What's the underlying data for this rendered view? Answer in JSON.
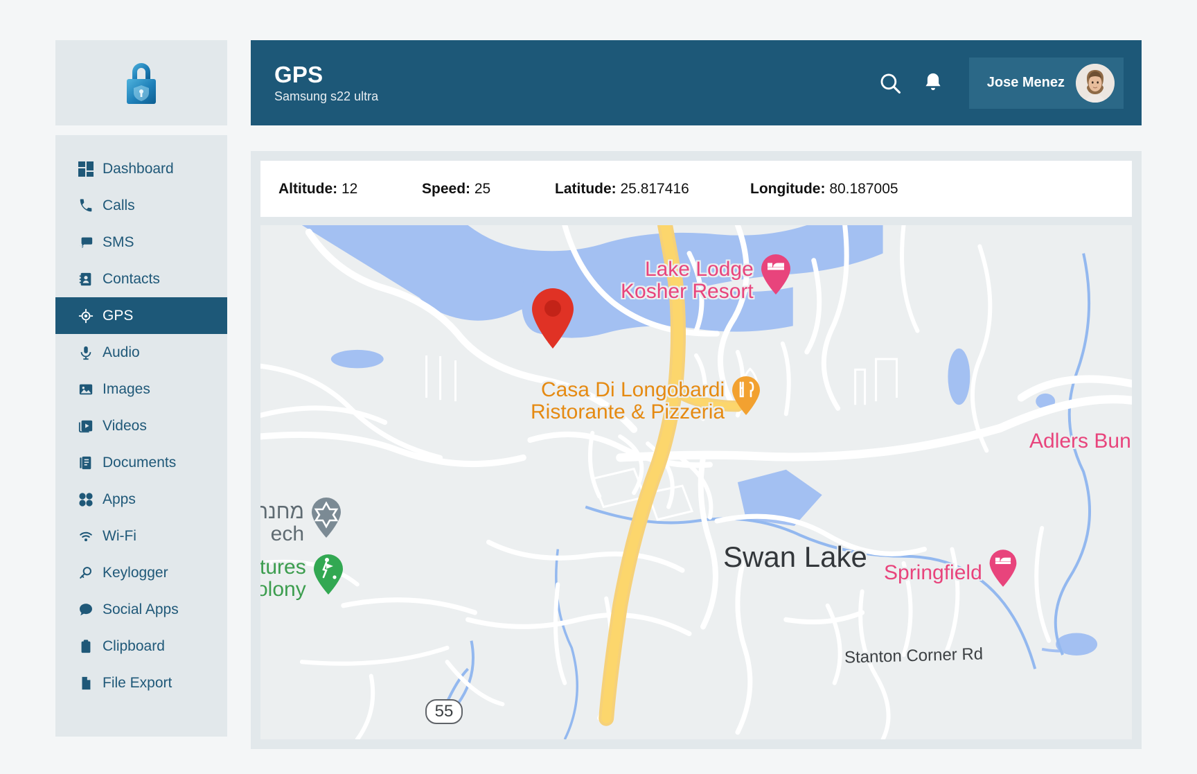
{
  "brand": {
    "logo_icon": "padlock-logo",
    "accent": "#1d5878",
    "panel_bg": "#e2e8eb"
  },
  "sidebar": {
    "items": [
      {
        "label": "Dashboard",
        "icon": "dashboard-icon",
        "active": false
      },
      {
        "label": "Calls",
        "icon": "phone-icon",
        "active": false
      },
      {
        "label": "SMS",
        "icon": "chat-icon",
        "active": false
      },
      {
        "label": "Contacts",
        "icon": "contacts-icon",
        "active": false
      },
      {
        "label": "GPS",
        "icon": "crosshair-icon",
        "active": true
      },
      {
        "label": "Audio",
        "icon": "microphone-icon",
        "active": false
      },
      {
        "label": "Images",
        "icon": "image-icon",
        "active": false
      },
      {
        "label": "Videos",
        "icon": "video-icon",
        "active": false
      },
      {
        "label": "Documents",
        "icon": "document-icon",
        "active": false
      },
      {
        "label": "Apps",
        "icon": "grid-dots-icon",
        "active": false
      },
      {
        "label": "Wi-Fi",
        "icon": "wifi-icon",
        "active": false
      },
      {
        "label": "Keylogger",
        "icon": "key-search-icon",
        "active": false
      },
      {
        "label": "Social Apps",
        "icon": "speech-bubble-icon",
        "active": false
      },
      {
        "label": "Clipboard",
        "icon": "clipboard-icon",
        "active": false
      },
      {
        "label": "File Export",
        "icon": "file-icon",
        "active": false
      }
    ]
  },
  "header": {
    "title": "GPS",
    "subtitle": "Samsung s22 ultra",
    "search_icon": "search-icon",
    "notification_icon": "bell-icon",
    "user_name": "Jose Menez",
    "avatar_icon": "user-avatar"
  },
  "stats": [
    {
      "label": "Altitude:",
      "value": "12"
    },
    {
      "label": "Speed:",
      "value": "25"
    },
    {
      "label": "Latitude:",
      "value": "25.817416"
    },
    {
      "label": "Longitude:",
      "value": "80.187005"
    }
  ],
  "map": {
    "center_marker": "location-pin",
    "place_label": "Swan Lake",
    "road_label": "Stanton Corner Rd",
    "route_shield": "55",
    "pois": [
      {
        "name": "Lake Lodge Kosher Resort",
        "line1": "Lake Lodge",
        "line2": "Kosher Resort",
        "color": "pink",
        "pin": "hotel-pin",
        "pin_color": "#e8447c"
      },
      {
        "name": "Casa Di Longobardi Ristorante & Pizzeria",
        "line1": "Casa Di Longobardi",
        "line2": "Ristorante & Pizzeria",
        "color": "orange",
        "pin": "restaurant-pin",
        "pin_color": "#f2a130"
      },
      {
        "name": "Adlers Bungalows",
        "line1": "Adlers Bungalows",
        "line2": "",
        "color": "pink",
        "pin": "hotel-pin",
        "pin_color": "#e8447c"
      },
      {
        "name": "Springfield",
        "line1": "Springfield",
        "line2": "",
        "color": "pink",
        "pin": "hotel-pin",
        "pin_color": "#e8447c"
      },
      {
        "name": "Machane (clipped)",
        "line1": "מחנה",
        "line2": "ech",
        "color": "gray",
        "pin": "star-of-david-pin",
        "pin_color": "#7b8a94"
      },
      {
        "name": "Pastures Colony (clipped)",
        "line1": "stures",
        "line2": "olony",
        "color": "green",
        "pin": "golf-pin",
        "pin_color": "#32a852"
      }
    ]
  }
}
